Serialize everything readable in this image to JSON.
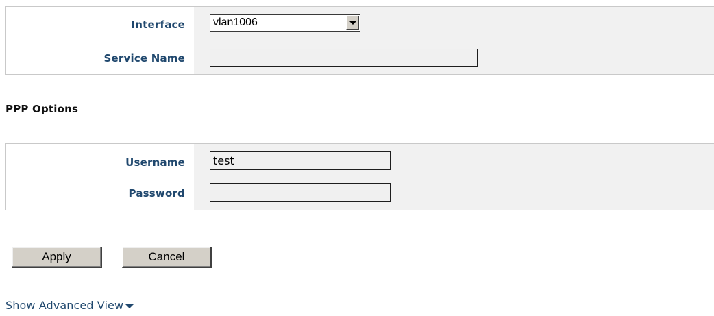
{
  "service": {
    "interface_label": "Interface",
    "interface_value": "vlan1006",
    "service_name_label": "Service Name",
    "service_name_value": ""
  },
  "ppp": {
    "section_title": "PPP Options",
    "username_label": "Username",
    "username_value": "test",
    "password_label": "Password",
    "password_value": ""
  },
  "actions": {
    "apply_label": "Apply",
    "cancel_label": "Cancel"
  },
  "advanced_link": "Show Advanced View",
  "icons": {
    "dropdown": "chevron-down-icon",
    "advanced": "caret-down-icon"
  },
  "colors": {
    "label": "#20486e",
    "field_bg": "#f1f1f1",
    "button_bg": "#d4d0c8"
  }
}
